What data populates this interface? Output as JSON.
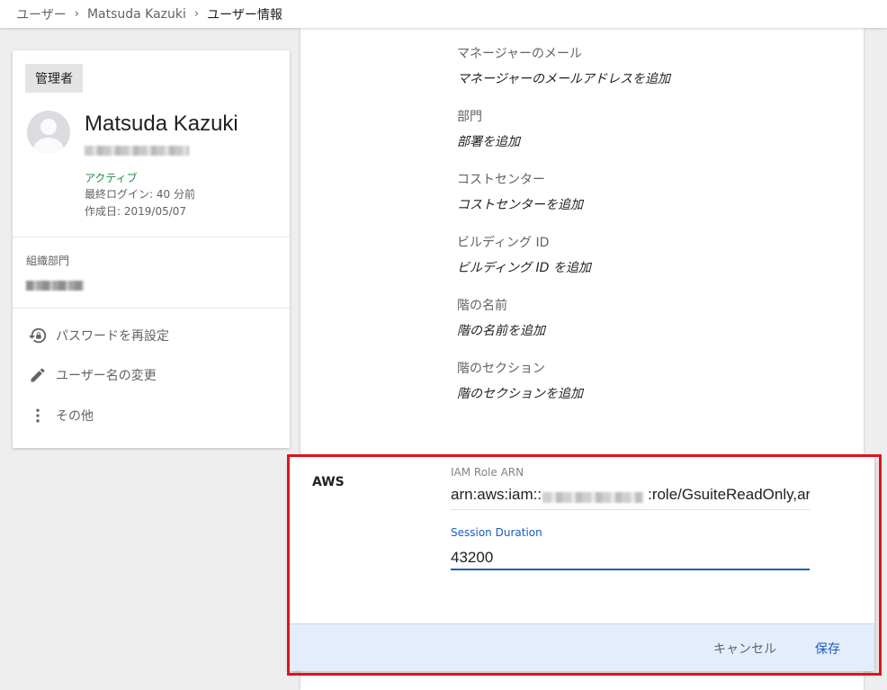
{
  "breadcrumb": {
    "items": [
      "ユーザー",
      "Matsuda Kazuki",
      "ユーザー情報"
    ],
    "separator": "›"
  },
  "profile": {
    "role": "管理者",
    "name": "Matsuda Kazuki",
    "status": "アクティブ",
    "last_login": "最終ログイン: 40 分前",
    "created": "作成日: 2019/05/07",
    "org_label": "組織部門",
    "actions": {
      "reset_password": "パスワードを再設定",
      "rename": "ユーザー名の変更",
      "more": "その他"
    }
  },
  "details": [
    {
      "label": "マネージャーのメール",
      "value": "マネージャーのメールアドレスを追加"
    },
    {
      "label": "部門",
      "value": "部署を追加"
    },
    {
      "label": "コストセンター",
      "value": "コストセンターを追加"
    },
    {
      "label": "ビルディング ID",
      "value": "ビルディング ID を追加"
    },
    {
      "label": "階の名前",
      "value": "階の名前を追加"
    },
    {
      "label": "階のセクション",
      "value": "階のセクションを追加"
    }
  ],
  "aws": {
    "title": "AWS",
    "iam_label": "IAM Role ARN",
    "iam_prefix": "arn:aws:iam::",
    "iam_suffix": ":role/GsuiteReadOnly,arn",
    "session_label": "Session Duration",
    "session_value": "43200",
    "cancel_label": "キャンセル",
    "save_label": "保存"
  },
  "colors": {
    "accent": "#1a5bc4",
    "active_status": "#1e8e3e",
    "highlight_border": "#e0141e",
    "footer_bg": "#e3edfb"
  },
  "icons": {
    "reset_password": "lock-reset-icon",
    "rename": "pencil-icon",
    "more": "more-vert-icon"
  }
}
